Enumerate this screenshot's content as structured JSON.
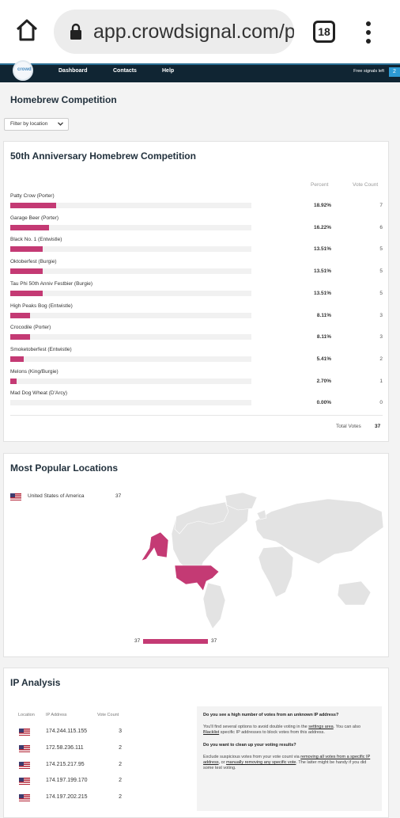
{
  "browser": {
    "url": "app.crowdsignal.com/p",
    "tab_count": "18",
    "icons": [
      "home-icon",
      "lock-icon",
      "tabs-icon",
      "kebab-menu-icon"
    ]
  },
  "nav": {
    "logo_text": "crowd",
    "links": [
      "Dashboard",
      "Contacts",
      "Help"
    ],
    "signals_label": "Free signals left",
    "signals_value": "2"
  },
  "page": {
    "title": "Homebrew Competition",
    "filter_label": "Filter by location"
  },
  "results": {
    "title": "50th Anniversary Homebrew Competition",
    "col_percent": "Percent",
    "col_votes": "Vote Count",
    "rows": [
      {
        "label": "Patty Crow (Porter)",
        "percent": "18.92%",
        "fraction": 0.1892,
        "count": "7"
      },
      {
        "label": "Garage Beer (Porter)",
        "percent": "16.22%",
        "fraction": 0.1622,
        "count": "6"
      },
      {
        "label": "Black No. 1 (Entwistle)",
        "percent": "13.51%",
        "fraction": 0.1351,
        "count": "5"
      },
      {
        "label": "Oktoberfest (Burgie)",
        "percent": "13.51%",
        "fraction": 0.1351,
        "count": "5"
      },
      {
        "label": "Tau Phi 50th Anniv Festbier (Burgie)",
        "percent": "13.51%",
        "fraction": 0.1351,
        "count": "5"
      },
      {
        "label": "High Peaks Bog (Entwistle)",
        "percent": "8.11%",
        "fraction": 0.0811,
        "count": "3"
      },
      {
        "label": "Crocodile (Porter)",
        "percent": "8.11%",
        "fraction": 0.0811,
        "count": "3"
      },
      {
        "label": "Smoketoberfest (Entwistle)",
        "percent": "5.41%",
        "fraction": 0.0541,
        "count": "2"
      },
      {
        "label": "Melons (King/Burgie)",
        "percent": "2.70%",
        "fraction": 0.027,
        "count": "1"
      },
      {
        "label": "Mad Dog Wheat (D'Arcy)",
        "percent": "0.00%",
        "fraction": 0,
        "count": "0"
      }
    ],
    "total_label": "Total Votes",
    "total_value": "37"
  },
  "locations": {
    "title": "Most Popular Locations",
    "items": [
      {
        "name": "United States of America",
        "count": "37"
      }
    ],
    "legend_min": "37",
    "legend_max": "37"
  },
  "ip": {
    "title": "IP Analysis",
    "col_location": "Location",
    "col_ip": "IP Address",
    "col_count": "Vote Count",
    "rows": [
      {
        "ip": "174.244.115.155",
        "count": "3"
      },
      {
        "ip": "172.58.236.111",
        "count": "2"
      },
      {
        "ip": "174.215.217.95",
        "count": "2"
      },
      {
        "ip": "174.197.199.170",
        "count": "2"
      },
      {
        "ip": "174.197.202.215",
        "count": "2"
      }
    ],
    "help": {
      "q1": "Do you see a high number of votes from an unknown IP address?",
      "p1_a": "You'll find several options to avoid double voting in the ",
      "p1_link1": "settings area",
      "p1_b": ". You can also ",
      "p1_link2": "Blacklist",
      "p1_c": " specific IP addresses to block votes from this address.",
      "q2": "Do you want to clean up your voting results?",
      "p2_a": "Exclude suspicious votes from your vote count via ",
      "p2_link1": "removing all votes from a specific IP address",
      "p2_b": ", or ",
      "p2_link2": "manually removing any specific vote",
      "p2_c": ". The latter might be handy if you did some test voting."
    }
  },
  "colors": {
    "accent": "#c43a74",
    "nav_bg": "#102533",
    "signal_badge": "#2d9ad4"
  }
}
